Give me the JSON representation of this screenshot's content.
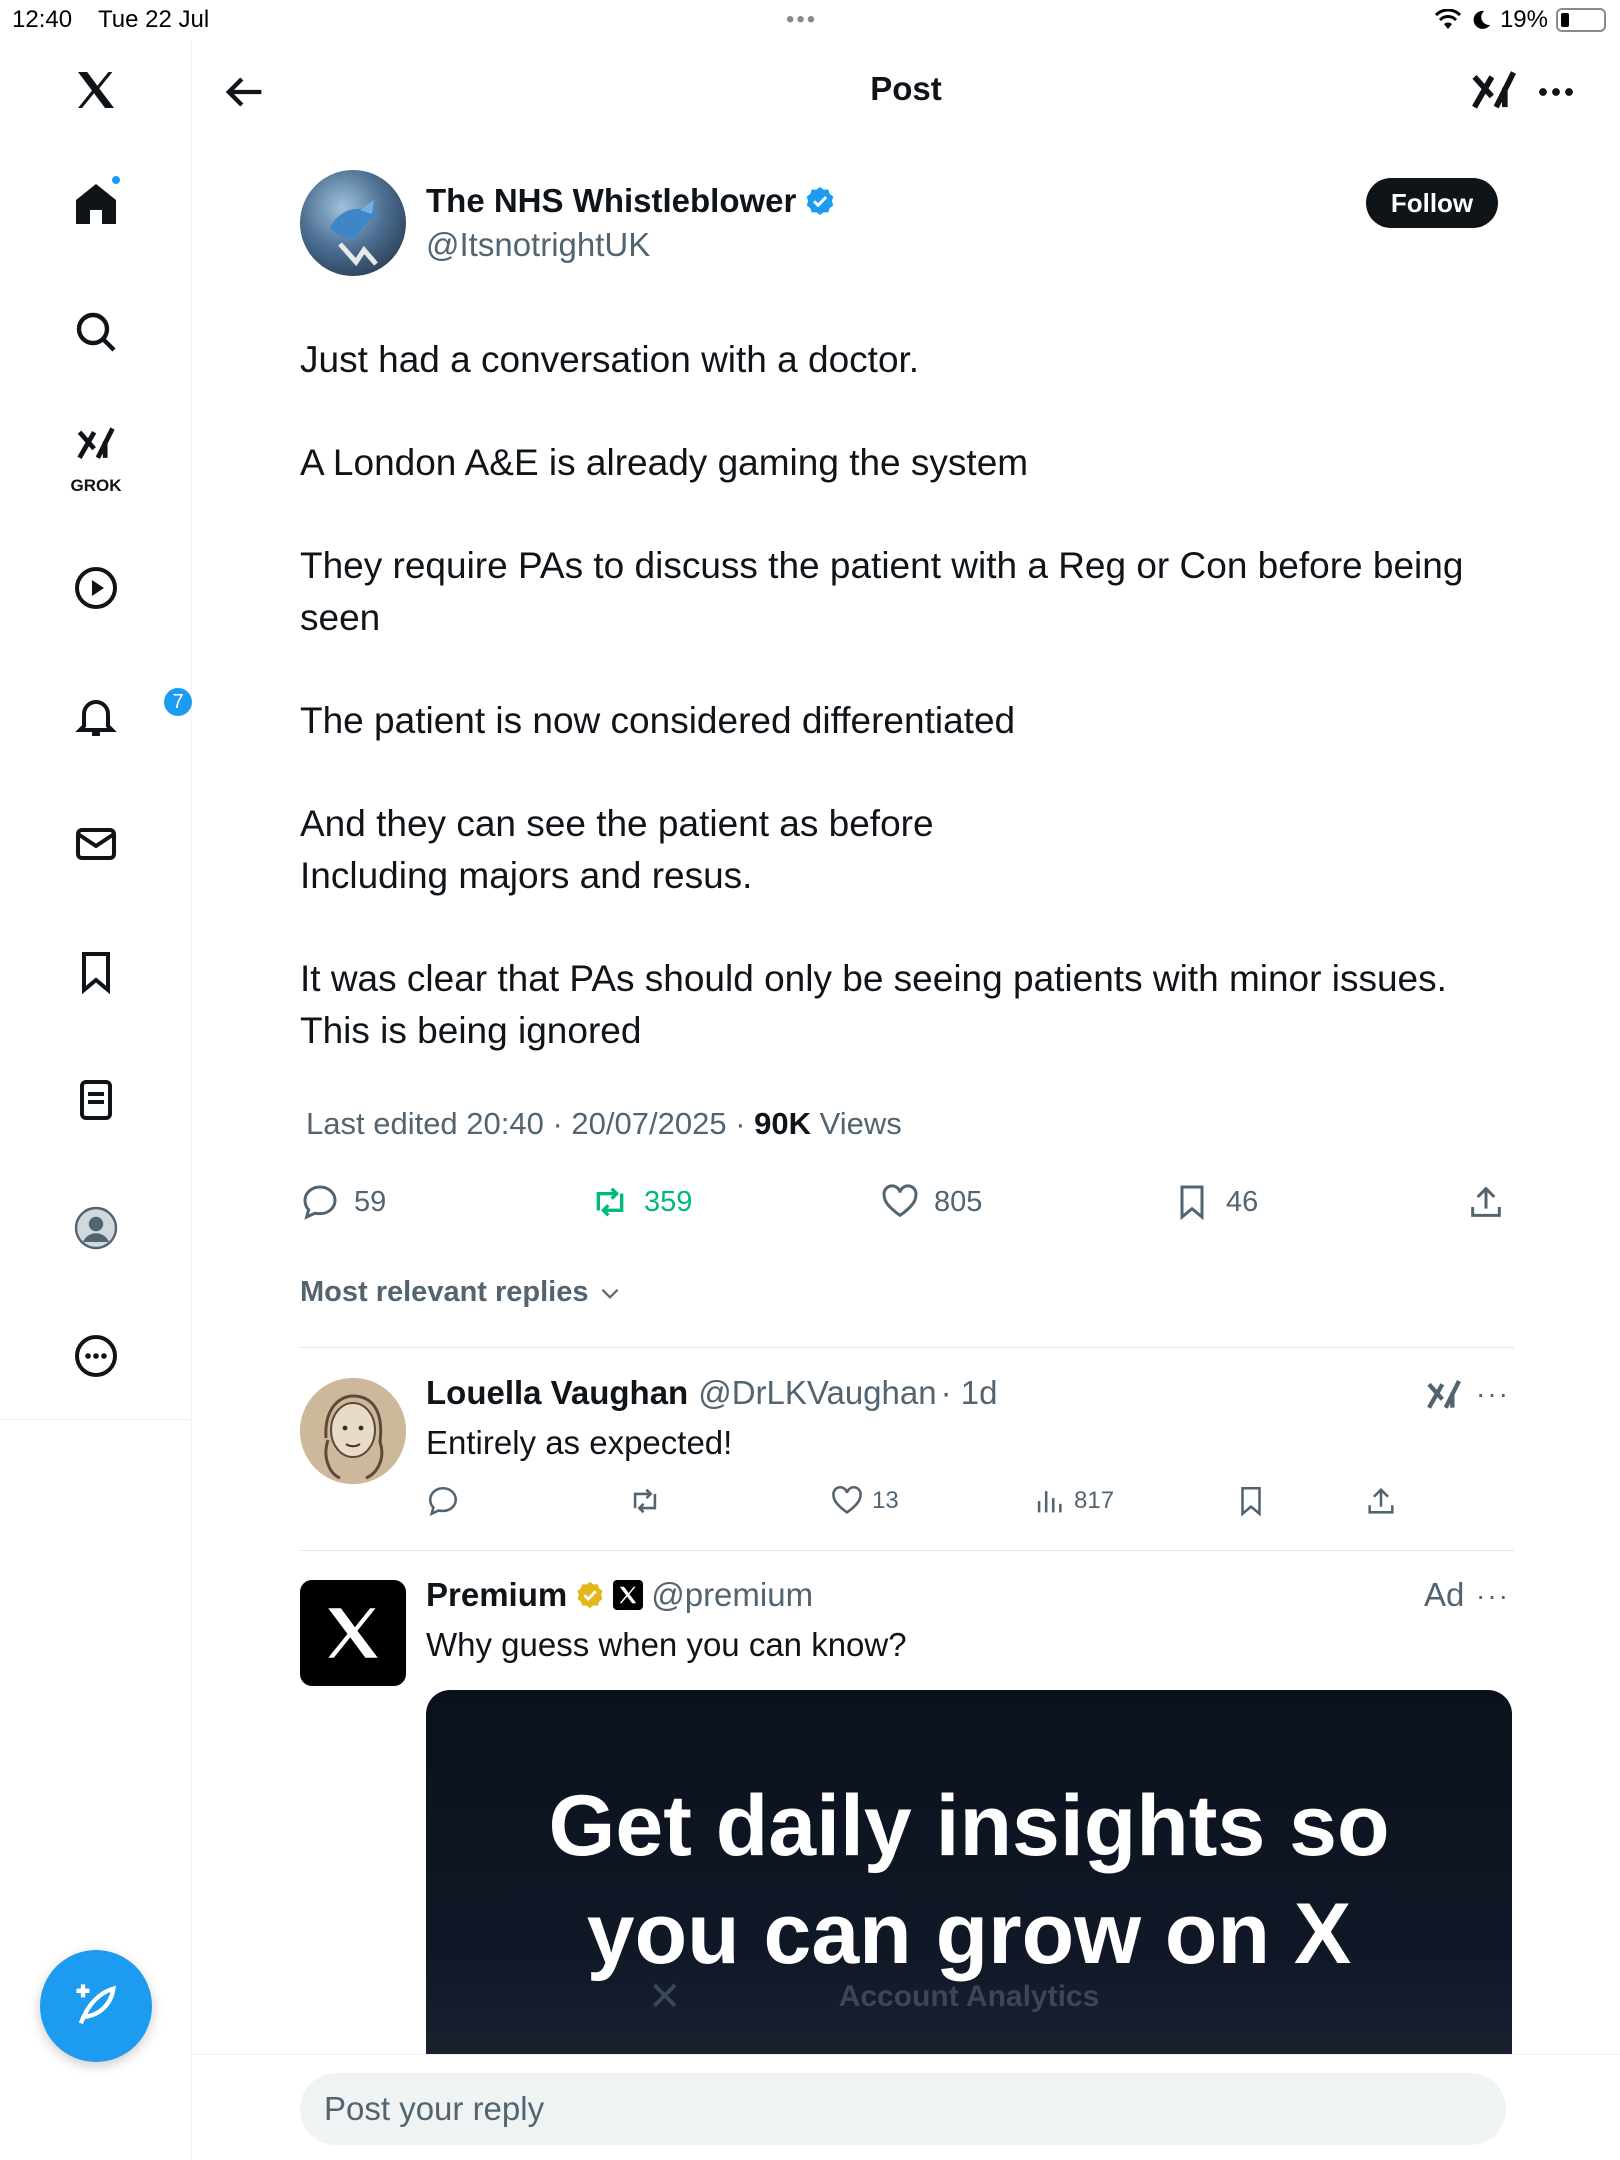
{
  "status_bar": {
    "time": "12:40",
    "date": "Tue 22 Jul",
    "battery": "19%"
  },
  "sidebar": {
    "items": [
      {
        "name": "x-logo",
        "label": ""
      },
      {
        "name": "home",
        "label": ""
      },
      {
        "name": "search",
        "label": ""
      },
      {
        "name": "grok",
        "label": "GROK"
      },
      {
        "name": "video",
        "label": ""
      },
      {
        "name": "notifications",
        "label": "",
        "badge": "7"
      },
      {
        "name": "messages",
        "label": ""
      },
      {
        "name": "bookmarks",
        "label": ""
      },
      {
        "name": "lists",
        "label": ""
      },
      {
        "name": "profile",
        "label": ""
      },
      {
        "name": "more",
        "label": ""
      }
    ],
    "grok_label": "GROK",
    "notif_badge": "7"
  },
  "header": {
    "title": "Post"
  },
  "post": {
    "author_name": "The NHS Whistleblower",
    "author_handle": "@ItsnotrightUK",
    "follow_label": "Follow",
    "paragraphs": [
      "Just had a conversation with a doctor.",
      "A London A&E is already gaming the system",
      "They require PAs to discuss the patient with a Reg or Con before being seen",
      "The patient is now considered differentiated",
      "And they can see the patient as before\nIncluding majors and resus.",
      "It was clear that PAs should only be seeing patients with minor issues.\nThis is being ignored"
    ],
    "edited": "Last edited 20:40 · 20/07/2025",
    "views_count": "90K",
    "views_label": "Views",
    "replies": "59",
    "reposts": "359",
    "likes": "805",
    "bookmarks": "46"
  },
  "replies_filter": "Most relevant replies",
  "reply": {
    "name": "Louella Vaughan",
    "handle": "@DrLKVaughan",
    "time": "· 1d",
    "text": "Entirely as expected!",
    "likes": "13",
    "views": "817"
  },
  "ad": {
    "name": "Premium",
    "handle": "@premium",
    "label": "Ad",
    "text": "Why guess when you can know?",
    "headline_line1": "Get daily insights so",
    "headline_line2": "you can grow on X",
    "sub": "Account Analytics"
  },
  "reply_input": {
    "placeholder": "Post your reply"
  },
  "colors": {
    "accent": "#1d9bf0",
    "repost": "#00ba7c",
    "secondary_text": "#536471"
  }
}
